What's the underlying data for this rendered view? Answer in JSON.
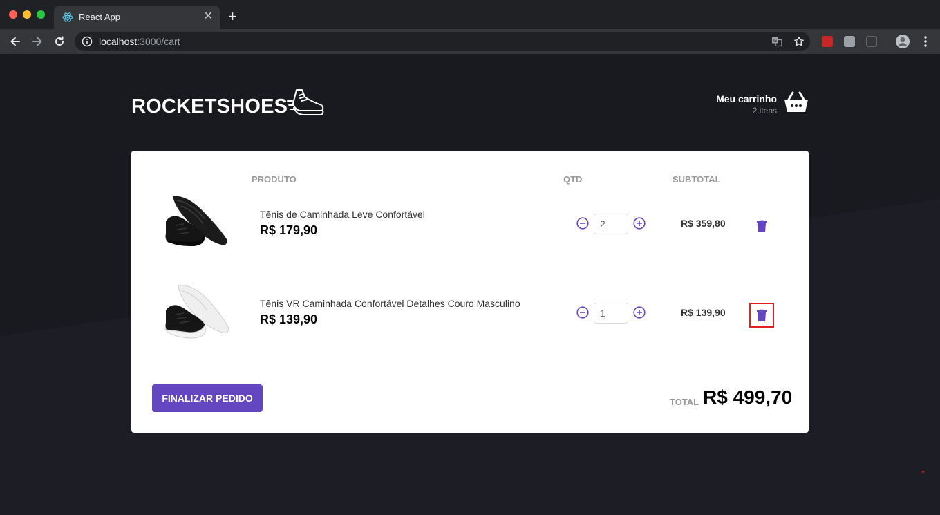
{
  "browser": {
    "tab_title": "React App",
    "tab_close": "✕",
    "new_tab": "+",
    "url_host": "localhost",
    "url_path": ":3000/cart"
  },
  "header": {
    "logo": "ROCKETSHOES",
    "cart_title": "Meu carrinho",
    "cart_count": "2 itens"
  },
  "table": {
    "headers": {
      "product": "PRODUTO",
      "qty": "QTD",
      "subtotal": "SUBTOTAL"
    }
  },
  "items": [
    {
      "title": "Tênis de Caminhada Leve Confortável",
      "price": "R$ 179,90",
      "qty": "2",
      "subtotal": "R$ 359,80",
      "sole_color": "#111111"
    },
    {
      "title": "Tênis VR Caminhada Confortável Detalhes Couro Masculino",
      "price": "R$ 139,90",
      "qty": "1",
      "subtotal": "R$ 139,90",
      "sole_color": "#f2f2f2"
    }
  ],
  "footer": {
    "finalize_label": "FINALIZAR PEDIDO",
    "total_label": "TOTAL",
    "total_value": "R$ 499,70"
  },
  "colors": {
    "accent": "#6446c0",
    "page_bg": "#191920",
    "highlight": "#e02020"
  }
}
